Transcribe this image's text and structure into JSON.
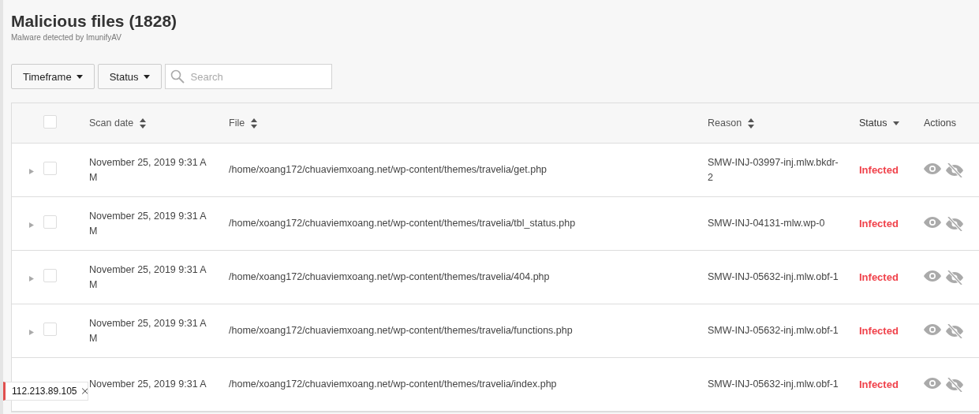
{
  "header": {
    "title": "Malicious files (1828)",
    "subtitle": "Malware detected by ImunifyAV"
  },
  "filters": [
    {
      "label": "Timeframe",
      "kind": "dropdown"
    },
    {
      "label": "Status",
      "kind": "dropdown"
    },
    {
      "placeholder": "Search",
      "kind": "search"
    }
  ],
  "table": {
    "select_all": {
      "checked": false
    },
    "columns": [
      {
        "label": "Scan date",
        "sortable": true,
        "sorted": false
      },
      {
        "label": "File",
        "sortable": true,
        "sorted": false
      },
      {
        "label": "Reason",
        "sortable": true,
        "sorted": false
      },
      {
        "label": "Status",
        "sortable": true,
        "sorted": true
      },
      {
        "label": "Actions",
        "sortable": false
      }
    ],
    "rows": [
      {
        "expanded": false,
        "checked": false,
        "date": "November 25, 2019 9:31 AM",
        "file": "/home/xoang172/chuaviemxoang.net/wp-content/themes/travelia/get.php",
        "reason": "SMW-INJ-03997-inj.mlw.bkdr-2",
        "status": "Infected"
      },
      {
        "expanded": false,
        "checked": false,
        "date": "November 25, 2019 9:31 AM",
        "file": "/home/xoang172/chuaviemxoang.net/wp-content/themes/travelia/tbl_status.php",
        "reason": "SMW-INJ-04131-mlw.wp-0",
        "status": "Infected"
      },
      {
        "expanded": false,
        "checked": false,
        "date": "November 25, 2019 9:31 AM",
        "file": "/home/xoang172/chuaviemxoang.net/wp-content/themes/travelia/404.php",
        "reason": "SMW-INJ-05632-inj.mlw.obf-1",
        "status": "Infected"
      },
      {
        "expanded": false,
        "checked": false,
        "date": "November 25, 2019 9:31 AM",
        "file": "/home/xoang172/chuaviemxoang.net/wp-content/themes/travelia/functions.php",
        "reason": "SMW-INJ-05632-inj.mlw.obf-1",
        "status": "Infected"
      },
      {
        "date": "November 25, 2019 9:31 A",
        "file": "/home/xoang172/chuaviemxoang.net/wp-content/themes/travelia/index.php",
        "reason": "SMW-INJ-05632-inj.mlw.obf-1",
        "status": "Infected"
      }
    ]
  },
  "ip_tag": {
    "label": "112.213.89.105"
  }
}
